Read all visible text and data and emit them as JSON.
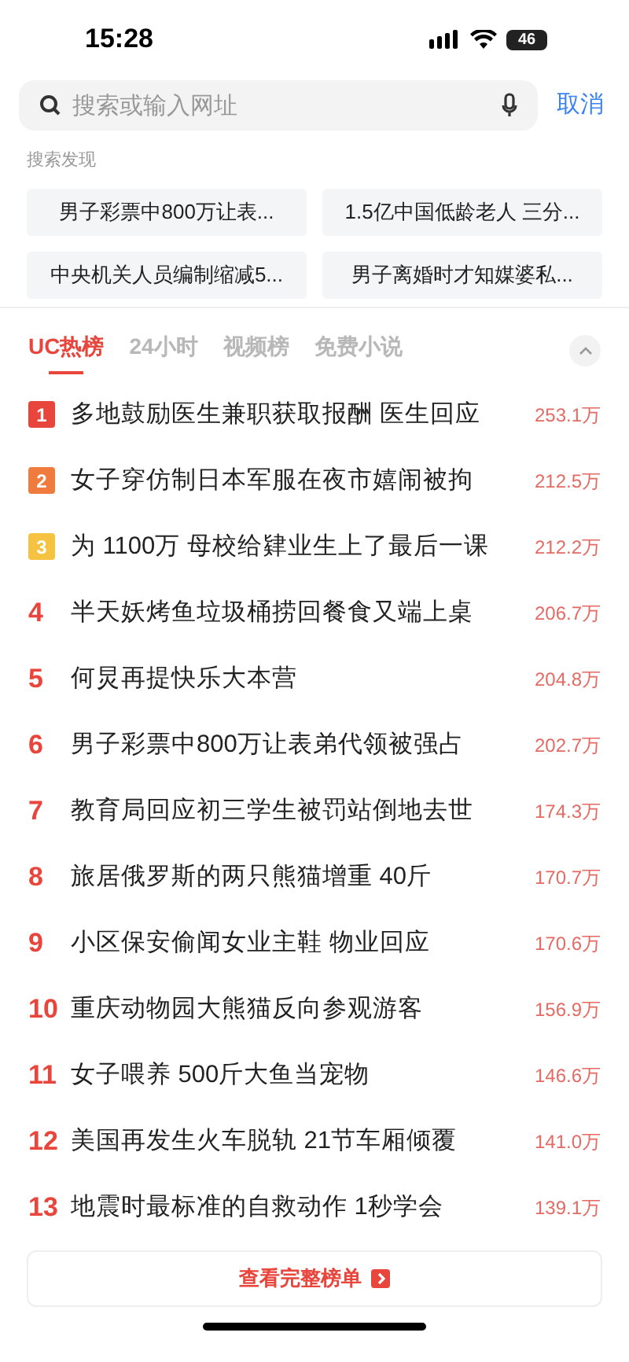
{
  "status_bar": {
    "time": "15:28",
    "battery": "46"
  },
  "search": {
    "placeholder": "搜索或输入网址",
    "cancel": "取消"
  },
  "discover": {
    "title": "搜索发现",
    "chips": [
      "男子彩票中800万让表...",
      "1.5亿中国低龄老人 三分...",
      "中央机关人员编制缩减5...",
      "男子离婚时才知媒婆私..."
    ]
  },
  "tabs": [
    {
      "label": "UC热榜",
      "selected": true
    },
    {
      "label": "24小时",
      "selected": false
    },
    {
      "label": "视频榜",
      "selected": false
    },
    {
      "label": "免费小说",
      "selected": false
    }
  ],
  "rows": [
    {
      "rank": "1",
      "kind": "badge",
      "color": "#e8453c",
      "title": "多地鼓励医生兼职获取报酬 医生回应",
      "count": "253.1万"
    },
    {
      "rank": "2",
      "kind": "badge",
      "color": "#f07b3f",
      "title": "女子穿仿制日本军服在夜市嬉闹被拘",
      "count": "212.5万"
    },
    {
      "rank": "3",
      "kind": "badge",
      "color": "#f5c242",
      "title": "为 1100万 母校给肄业生上了最后一课",
      "count": "212.2万"
    },
    {
      "rank": "4",
      "kind": "plain",
      "title": "半天妖烤鱼垃圾桶捞回餐食又端上桌",
      "count": "206.7万"
    },
    {
      "rank": "5",
      "kind": "plain",
      "title": "何炅再提快乐大本营",
      "count": "204.8万"
    },
    {
      "rank": "6",
      "kind": "plain",
      "title": "男子彩票中800万让表弟代领被强占",
      "count": "202.7万"
    },
    {
      "rank": "7",
      "kind": "plain",
      "title": "教育局回应初三学生被罚站倒地去世",
      "count": "174.3万"
    },
    {
      "rank": "8",
      "kind": "plain",
      "title": "旅居俄罗斯的两只熊猫增重 40斤",
      "count": "170.7万"
    },
    {
      "rank": "9",
      "kind": "plain",
      "title": "小区保安偷闻女业主鞋 物业回应",
      "count": "170.6万"
    },
    {
      "rank": "10",
      "kind": "plain",
      "title": "重庆动物园大熊猫反向参观游客",
      "count": "156.9万"
    },
    {
      "rank": "11",
      "kind": "plain",
      "title": "女子喂养 500斤大鱼当宠物",
      "count": "146.6万"
    },
    {
      "rank": "12",
      "kind": "plain",
      "title": "美国再发生火车脱轨 21节车厢倾覆",
      "count": "141.0万"
    },
    {
      "rank": "13",
      "kind": "plain",
      "title": "地震时最标准的自救动作 1秒学会",
      "count": "139.1万"
    }
  ],
  "full_list_button": "查看完整榜单"
}
